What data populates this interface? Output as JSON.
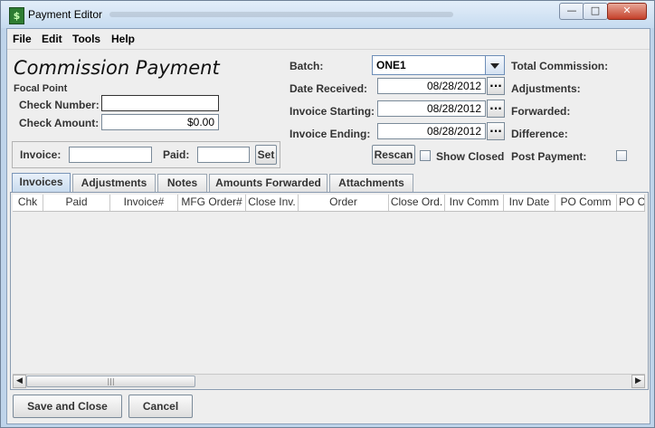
{
  "window": {
    "title": "Payment Editor",
    "app_icon": "$",
    "title_extra_blurred": "",
    "controls": {
      "minimize": "—",
      "maximize": "□",
      "close": "✕"
    }
  },
  "menu": {
    "file": "File",
    "edit": "Edit",
    "tools": "Tools",
    "help": "Help"
  },
  "form": {
    "heading": "Commission Payment",
    "customer": "Focal Point",
    "check_number_label": "Check Number:",
    "check_number_value": "",
    "check_amount_label": "Check Amount:",
    "check_amount_value": "$0.00",
    "batch_label": "Batch:",
    "batch_value": "ONE1",
    "date_received_label": "Date Received:",
    "date_received_value": "08/28/2012",
    "invoice_starting_label": "Invoice Starting:",
    "invoice_starting_value": "08/28/2012",
    "invoice_ending_label": "Invoice Ending:",
    "invoice_ending_value": "08/28/2012",
    "ellipsis": "...",
    "total_commission_label": "Total Commission:",
    "adjustments_label": "Adjustments:",
    "forwarded_label": "Forwarded:",
    "difference_label": "Difference:",
    "post_payment_label": "Post Payment:",
    "invoice_label": "Invoice:",
    "invoice_value": "",
    "paid_label": "Paid:",
    "paid_value": "",
    "set_button": "Set",
    "rescan_button": "Rescan",
    "show_closed_label": "Show Closed"
  },
  "tabs": [
    {
      "label": "Invoices"
    },
    {
      "label": "Adjustments"
    },
    {
      "label": "Notes"
    },
    {
      "label": "Amounts Forwarded"
    },
    {
      "label": "Attachments"
    }
  ],
  "grid": {
    "columns": [
      "Chk",
      "Paid",
      "Invoice#",
      "MFG Order#",
      "Close Inv.",
      "Order",
      "Close Ord.",
      "Inv Comm",
      "Inv Date",
      "PO Comm",
      "PO Co"
    ],
    "rows": []
  },
  "scrollbar": {
    "left_arrow": "◀",
    "right_arrow": "▶",
    "thumb_grip": "|||"
  },
  "footer": {
    "save_close": "Save and Close",
    "cancel": "Cancel"
  }
}
